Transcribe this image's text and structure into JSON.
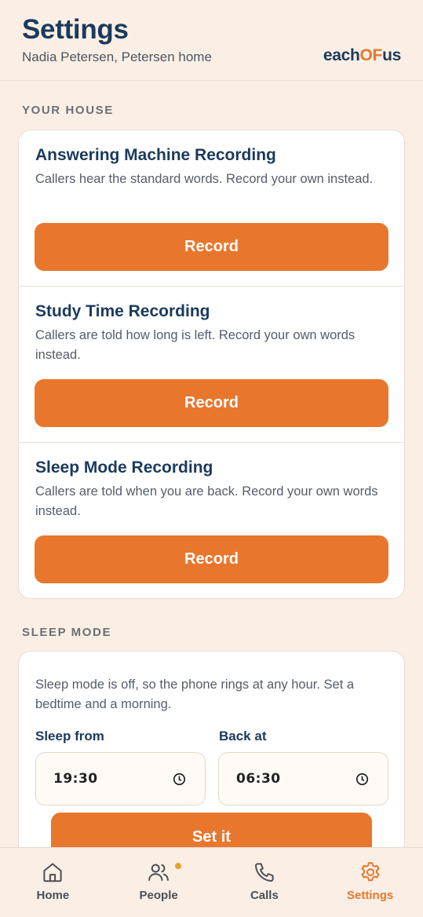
{
  "header": {
    "title": "Settings",
    "subtitle": "Nadia Petersen, Petersen home",
    "logo_part1": "each",
    "logo_part2": "OF",
    "logo_part3": "us"
  },
  "your_house": {
    "section_label": "YOUR HOUSE",
    "items": [
      {
        "title": "Answering Machine Recording",
        "description": "Callers hear the standard words. Record your own instead.",
        "button": "Record"
      },
      {
        "title": "Study Time Recording",
        "description": "Callers are told how long is left. Record your own words instead.",
        "button": "Record"
      },
      {
        "title": "Sleep Mode Recording",
        "description": "Callers are told when you are back. Record your own words instead.",
        "button": "Record"
      }
    ]
  },
  "sleep_mode": {
    "section_label": "SLEEP MODE",
    "description": "Sleep mode is off, so the phone rings at any hour. Set a bedtime and a morning.",
    "from_label": "Sleep from",
    "from_value": "19:30",
    "back_label": "Back at",
    "back_value": "06:30",
    "button": "Set it"
  },
  "tabs": [
    {
      "label": "Home",
      "icon": "home-icon",
      "active": false
    },
    {
      "label": "People",
      "icon": "people-icon",
      "active": false,
      "badge": true
    },
    {
      "label": "Calls",
      "icon": "phone-icon",
      "active": false
    },
    {
      "label": "Settings",
      "icon": "gear-icon",
      "active": true
    }
  ],
  "colors": {
    "accent": "#e8772d",
    "navy": "#1b3a5c",
    "background": "#fbefe5",
    "badge": "#e8a12d"
  }
}
